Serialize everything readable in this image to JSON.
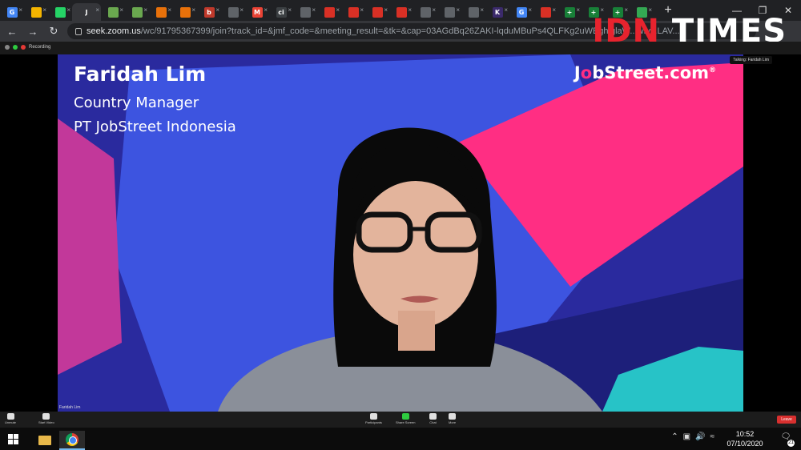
{
  "browser": {
    "tabs": [
      {
        "icon": "google-icon",
        "label": "",
        "color": "#4285f4",
        "glyph": "G"
      },
      {
        "icon": "folder-icon",
        "label": "",
        "color": "#f4b400",
        "glyph": ""
      },
      {
        "icon": "whatsapp-icon",
        "label": "",
        "color": "#25d366",
        "glyph": ""
      },
      {
        "icon": "zoom-icon",
        "label": "J",
        "color": "#35363a",
        "glyph": "J",
        "active": true
      },
      {
        "icon": "frog-icon",
        "label": "",
        "color": "#6aa84f",
        "glyph": ""
      },
      {
        "icon": "frog-icon",
        "label": "",
        "color": "#6aa84f",
        "glyph": ""
      },
      {
        "icon": "shop-icon",
        "label": "",
        "color": "#e8710a",
        "glyph": ""
      },
      {
        "icon": "shop-icon",
        "label": "",
        "color": "#e8710a",
        "glyph": ""
      },
      {
        "icon": "b-logo-icon",
        "label": "",
        "color": "#c0392b",
        "glyph": "b"
      },
      {
        "icon": "globe-icon",
        "label": "",
        "color": "#5f6368",
        "glyph": ""
      },
      {
        "icon": "gmail-icon",
        "label": "",
        "color": "#ea4335",
        "glyph": "M"
      },
      {
        "icon": "ci-icon",
        "label": "",
        "color": "#3c4043",
        "glyph": "ci"
      },
      {
        "icon": "globe-icon",
        "label": "",
        "color": "#5f6368",
        "glyph": ""
      },
      {
        "icon": "news-icon",
        "label": "",
        "color": "#d93025",
        "glyph": ""
      },
      {
        "icon": "news-icon",
        "label": "",
        "color": "#d93025",
        "glyph": ""
      },
      {
        "icon": "news-icon",
        "label": "",
        "color": "#d93025",
        "glyph": ""
      },
      {
        "icon": "news-icon",
        "label": "",
        "color": "#d93025",
        "glyph": ""
      },
      {
        "icon": "globe-icon",
        "label": "",
        "color": "#5f6368",
        "glyph": ""
      },
      {
        "icon": "globe-icon",
        "label": "",
        "color": "#5f6368",
        "glyph": ""
      },
      {
        "icon": "globe-icon",
        "label": "",
        "color": "#5f6368",
        "glyph": ""
      },
      {
        "icon": "k-logo-icon",
        "label": "",
        "color": "#3b2a6b",
        "glyph": "K"
      },
      {
        "icon": "google-icon",
        "label": "",
        "color": "#4285f4",
        "glyph": "G"
      },
      {
        "icon": "doc-icon",
        "label": "",
        "color": "#d93025",
        "glyph": ""
      },
      {
        "icon": "plus-doc-icon",
        "label": "",
        "color": "#188038",
        "glyph": "+"
      },
      {
        "icon": "plus-doc-icon",
        "label": "",
        "color": "#188038",
        "glyph": "+"
      },
      {
        "icon": "plus-doc-icon",
        "label": "",
        "color": "#188038",
        "glyph": "+"
      },
      {
        "icon": "shield-icon",
        "label": "",
        "color": "#34a853",
        "glyph": ""
      }
    ],
    "new_tab_glyph": "+",
    "url_host": "seek.zoom.us",
    "url_path": "/wc/91795367399/join?track_id=&jmf_code=&meeting_result=&tk=&cap=03AGdBq26ZAKI-lqduMBuPs4QLFKg2uWEghiglaW...wfy...LAV..."
  },
  "watermark": {
    "part1": "IDN",
    "part2": "TIMES"
  },
  "zoom": {
    "recording_label": "Recording",
    "talking_label": "Talking: Faridah Lim",
    "participant_badge": "Faridah Lim",
    "controls": [
      {
        "label": "Unmute",
        "color": "#e0e0e0",
        "icon": "microphone-muted-icon"
      },
      {
        "label": "Start Video",
        "color": "#e0e0e0",
        "icon": "video-off-icon"
      },
      {
        "label": "Participants",
        "color": "#e0e0e0",
        "icon": "participants-icon"
      },
      {
        "label": "Share Screen",
        "color": "#2ecc40",
        "icon": "share-screen-icon"
      },
      {
        "label": "Chat",
        "color": "#e0e0e0",
        "icon": "chat-icon"
      },
      {
        "label": "More",
        "color": "#e0e0e0",
        "icon": "more-icon"
      }
    ],
    "leave_label": "Leave"
  },
  "video": {
    "speaker_name": "Faridah Lim",
    "speaker_title": "Country Manager",
    "speaker_company": "PT JobStreet Indonesia",
    "brand_pre": "J",
    "brand_o": "o",
    "brand_post": "bStreet.com",
    "brand_mark": "®",
    "colors": {
      "bg": "#2a2a9e",
      "blue": "#3d54e0",
      "pink": "#ff2e83",
      "magenta": "#c2389a",
      "teal": "#27c3c7",
      "navy": "#1d1f7a"
    }
  },
  "taskbar": {
    "time": "10:52",
    "date": "07/10/2020",
    "notifications": "21",
    "tray_icons": [
      "chevron-up-icon",
      "network-icon",
      "volume-icon",
      "wifi-icon"
    ]
  }
}
